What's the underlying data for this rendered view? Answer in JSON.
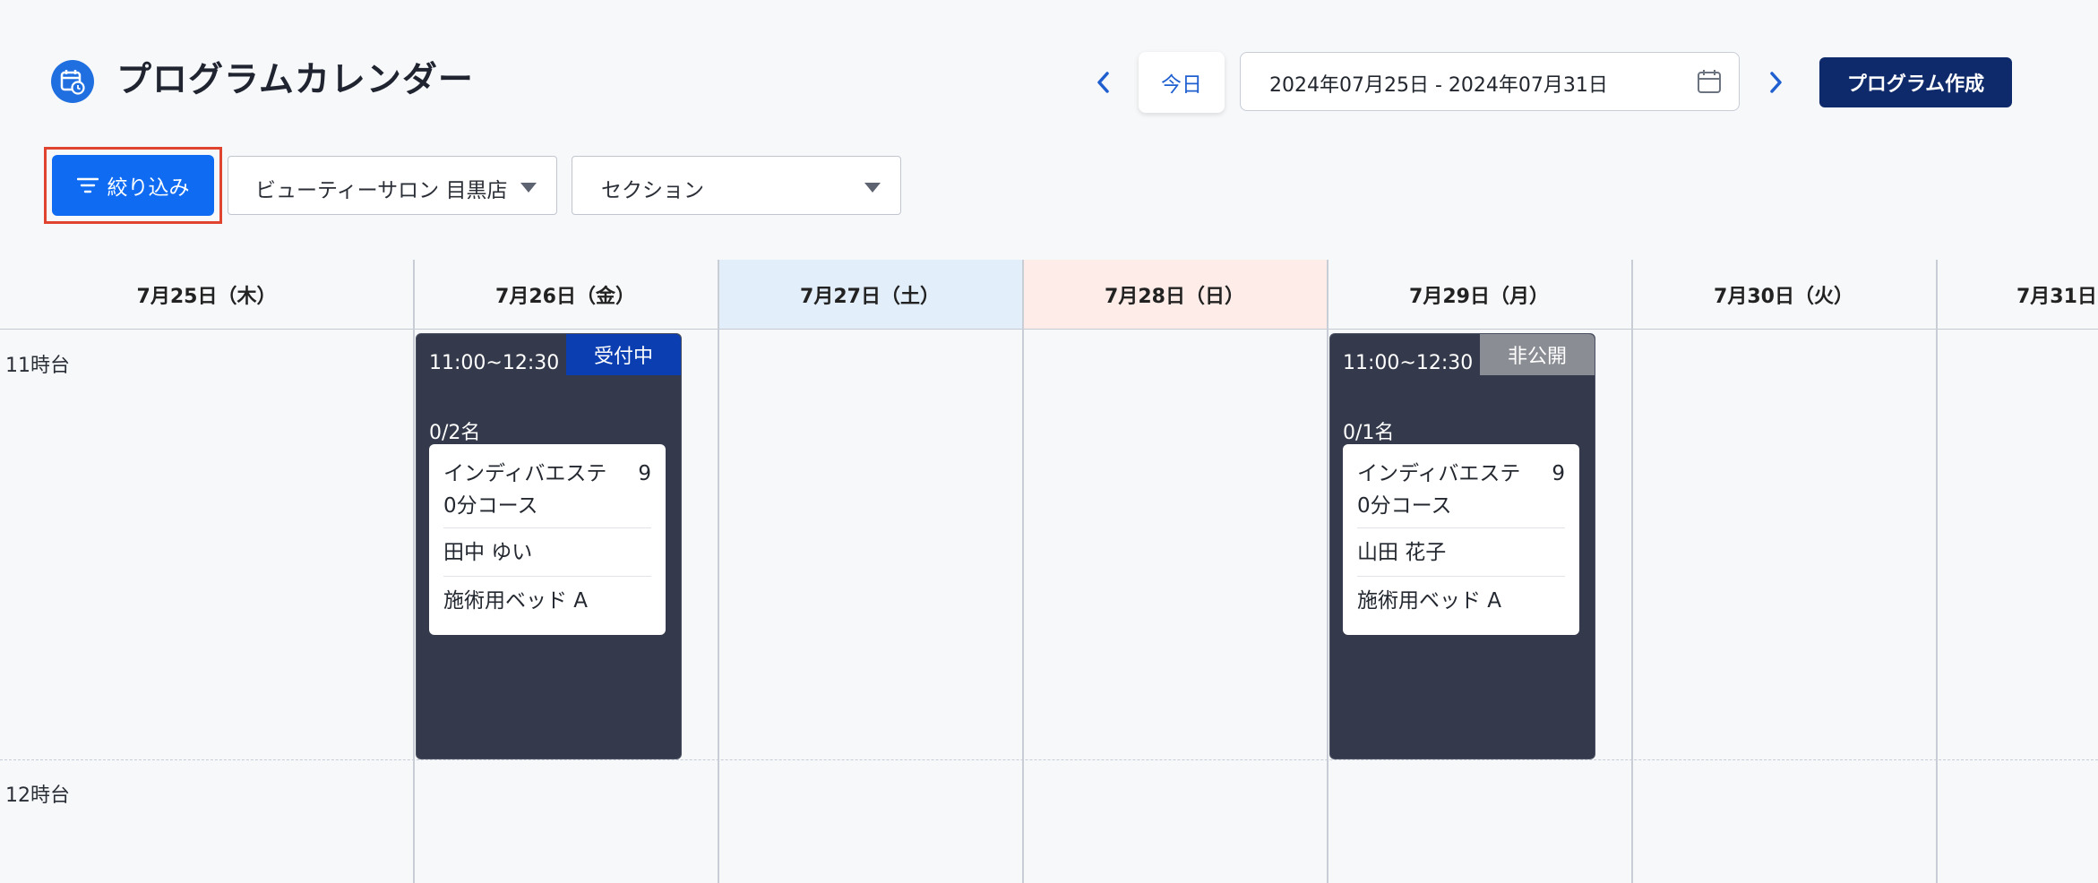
{
  "header": {
    "title": "プログラムカレンダー",
    "title_icon": "calendar-clock-icon",
    "prev_icon": "chevron-left-icon",
    "next_icon": "chevron-right-icon",
    "today_label": "今日",
    "date_range": "2024年07月25日 - 2024年07月31日",
    "date_picker_icon": "calendar-icon",
    "create_label": "プログラム作成"
  },
  "filters": {
    "filter_label": "絞り込み",
    "store_value": "ビューティーサロン 目黒店",
    "section_placeholder": "セクション"
  },
  "calendar": {
    "days": [
      {
        "label": "7月25日（木）"
      },
      {
        "label": "7月26日（金）"
      },
      {
        "label": "7月27日（土）"
      },
      {
        "label": "7月28日（日）"
      },
      {
        "label": "7月29日（月）"
      },
      {
        "label": "7月30日（火）"
      },
      {
        "label": "7月31日"
      }
    ],
    "hours": [
      "11時台",
      "12時台"
    ],
    "events": [
      {
        "time": "11:00~12:30",
        "status": "受付中",
        "count": "0/2名",
        "course": "インディバエステ　90分コース",
        "course_name": "インディバエステ　",
        "course_suffix": "9",
        "course_line2": "0分コース",
        "staff": "田中 ゆい",
        "resource": "施術用ベッド A"
      },
      {
        "time": "11:00~12:30",
        "status": "非公開",
        "count": "0/1名",
        "course": "インディバエステ　90分コース",
        "course_name": "インディバエステ　",
        "course_suffix": "9",
        "course_line2": "0分コース",
        "staff": "山田 花子",
        "resource": "施術用ベッド A"
      }
    ]
  },
  "colors": {
    "accent": "#0f6cf2",
    "create_button": "#0f2a6b",
    "event_bg": "#343a4b",
    "status_open": "#0b3eb0",
    "status_private": "#8a8d93",
    "saturday_bg": "#e3eefb",
    "sunday_bg": "#fdece7"
  }
}
